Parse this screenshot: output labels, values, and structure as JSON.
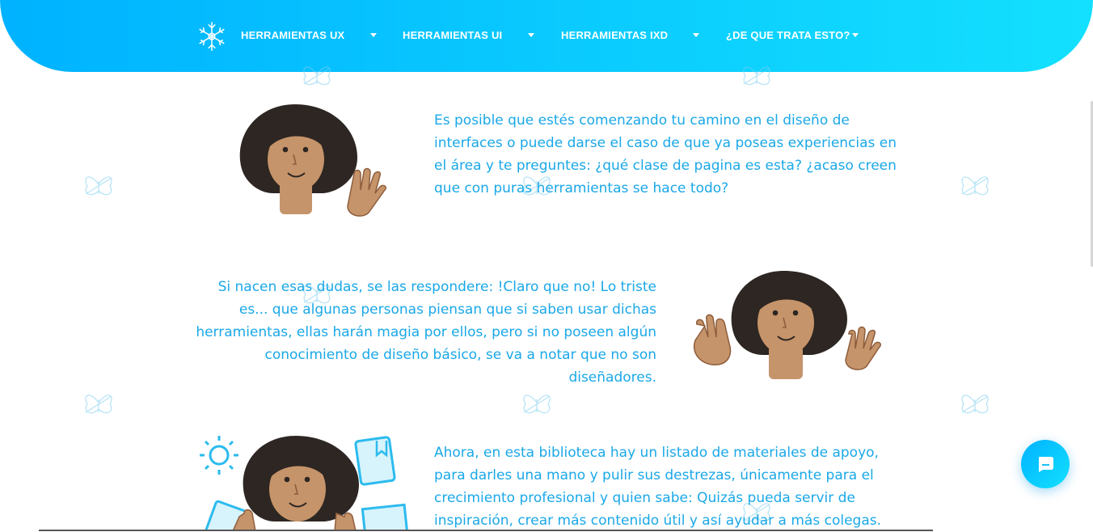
{
  "nav": {
    "items": [
      {
        "label": "HERRAMIENTAS UX"
      },
      {
        "label": "HERRAMIENTAS UI"
      },
      {
        "label": "HERRAMIENTAS IXD"
      },
      {
        "label": "¿DE QUE TRATA ESTO?"
      }
    ]
  },
  "sections": [
    {
      "text": "Es posible que estés comenzando tu camino en el diseño de interfaces o puede darse el caso de que ya poseas experiencias en el área y te preguntes: ¿qué clase de pagina es esta? ¿acaso creen que con puras herramientas se hace todo?"
    },
    {
      "text": "Si nacen esas dudas, se las respondere: !Claro que no! Lo triste es... que algunas personas piensan que si saben usar dichas herramientas, ellas harán magia por ellos, pero si no poseen algún conocimiento de diseño básico, se va a notar que no son diseñadores."
    },
    {
      "text": "Ahora, en esta biblioteca hay un listado de materiales de apoyo, para darles una mano y pulir sus destrezas, únicamente para el crecimiento profesional y quien sabe: Quizás pueda servir de inspiración, crear más contenido útil y así ayudar a más colegas."
    }
  ],
  "icons": {
    "logo": "snowflake-logo-icon",
    "chat": "chat-bubble-icon",
    "background": "butterfly-outline-icon"
  },
  "colors": {
    "accent_start": "#00b2ff",
    "accent_end": "#13e0fe",
    "text": "#1aa8e8"
  }
}
